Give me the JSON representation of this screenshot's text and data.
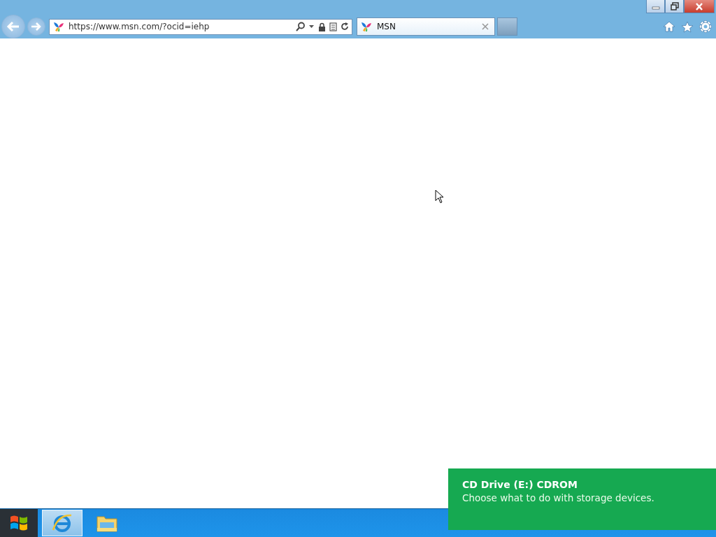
{
  "browser": {
    "address": "https://www.msn.com/?ocid=iehp",
    "tabs": [
      {
        "title": "MSN",
        "selected": true
      }
    ]
  },
  "taskbar": {
    "items": [
      {
        "kind": "browser",
        "selected": true
      },
      {
        "kind": "folder",
        "selected": false
      }
    ]
  },
  "notification": {
    "title": "CD Drive (E:) CDROM",
    "message": "Choose what to do with storage devices."
  }
}
